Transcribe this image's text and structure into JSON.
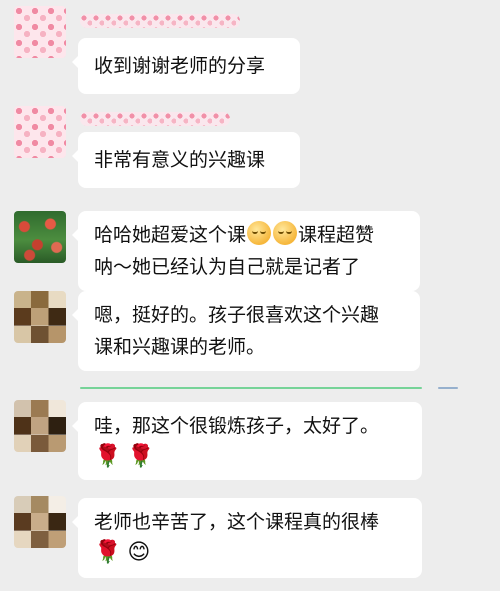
{
  "messages": [
    {
      "text": "收到谢谢老师的分享",
      "lines": [],
      "emojis": []
    },
    {
      "text": "非常有意义的兴趣课",
      "lines": [],
      "emojis": []
    },
    {
      "text_line1_a": "哈哈她超爱这个课",
      "text_line1_b": "课程超赞",
      "text_line2": "呐～她已经认为自己就是记者了",
      "emojis": []
    },
    {
      "text_line1": "嗯，挺好的。孩子很喜欢这个兴趣",
      "text_line2": "课和兴趣课的老师。",
      "emojis": []
    },
    {
      "text": "哇，那这个很锻炼孩子，太好了。",
      "emojis": [
        "🌹",
        "🌹"
      ]
    },
    {
      "text": "老师也辛苦了，这个课程真的很棒",
      "emojis": [
        "🌹",
        "😊"
      ]
    }
  ],
  "icons": {
    "rose": "rose-icon",
    "smile": "smile-icon",
    "blush": "blush-face-icon"
  },
  "colors": {
    "background": "#ededed",
    "bubble": "#ffffff",
    "accent_line": "#35c46a"
  }
}
